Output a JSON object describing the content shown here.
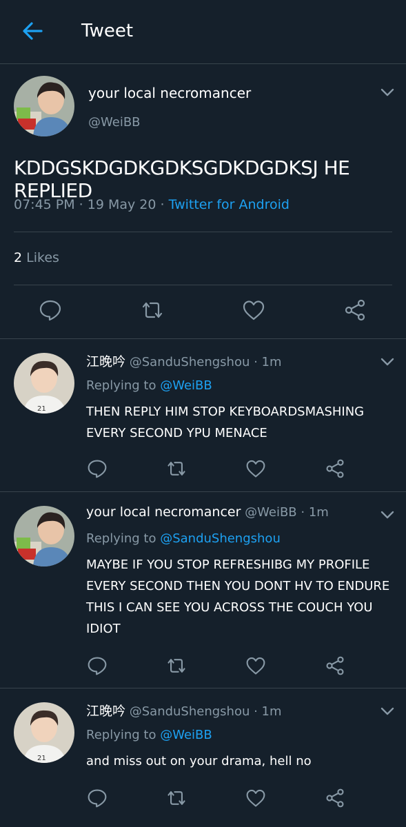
{
  "header": {
    "title": "Tweet"
  },
  "main_tweet": {
    "name": "your local necromancer",
    "handle": "@WeiBB",
    "text": "KDDGSKDGDKGDKSGDKDGDKSJ HE REPLIED",
    "time": "07:45 PM · 19 May 20 · ",
    "source": "Twitter for Android",
    "likes_count": "2",
    "likes_label": " Likes"
  },
  "replies": [
    {
      "name": "江晚吟",
      "meta": " @SanduShengshou · 1m",
      "replying_prefix": "Replying to ",
      "replying_handle": "@WeiBB",
      "text": "THEN REPLY HIM STOP KEYBOARDSMASHING EVERY SECOND YPU MENACE"
    },
    {
      "name": "your local necromancer",
      "meta": " @WeiBB · 1m",
      "replying_prefix": "Replying to ",
      "replying_handle": "@SanduShengshou",
      "text": "MAYBE IF YOU STOP REFRESHIBG MY PROFILE EVERY SECOND THEN YOU DONT HV TO ENDURE THIS I CAN SEE YOU ACROSS THE COUCH YOU IDIOT"
    },
    {
      "name": "江晚吟",
      "meta": " @SanduShengshou · 1m",
      "replying_prefix": "Replying to ",
      "replying_handle": "@WeiBB",
      "text": "and miss out on your drama, hell no"
    }
  ],
  "icons": {
    "back": "arrow-left-icon",
    "reply": "comment-icon",
    "retweet": "retweet-icon",
    "like": "heart-icon",
    "share": "share-icon",
    "more": "chevron-down-icon"
  },
  "colors": {
    "background": "#15202b",
    "accent": "#1da1f2",
    "secondary_text": "#8899a6",
    "divider": "#38444d"
  }
}
